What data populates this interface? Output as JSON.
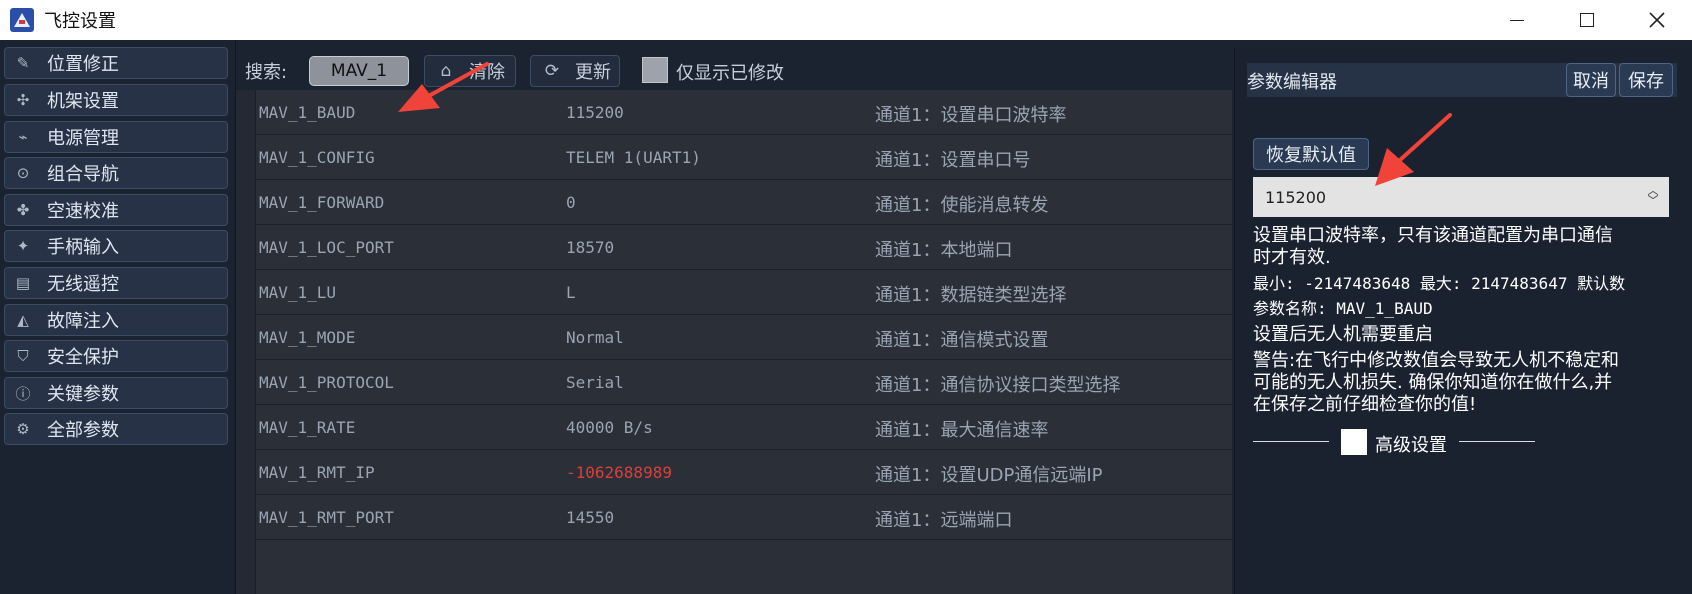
{
  "window": {
    "title": "飞控设置"
  },
  "sidebar": {
    "items": [
      {
        "label": "位置修正",
        "icon": "edit-icon"
      },
      {
        "label": "机架设置",
        "icon": "drone-icon"
      },
      {
        "label": "电源管理",
        "icon": "battery-icon"
      },
      {
        "label": "组合导航",
        "icon": "compass-icon"
      },
      {
        "label": "空速校准",
        "icon": "fan-icon"
      },
      {
        "label": "手柄输入",
        "icon": "gamepad-icon"
      },
      {
        "label": "无线遥控",
        "icon": "radio-icon"
      },
      {
        "label": "故障注入",
        "icon": "fault-icon"
      },
      {
        "label": "安全保护",
        "icon": "shield-icon"
      },
      {
        "label": "关键参数",
        "icon": "alert-icon"
      },
      {
        "label": "全部参数",
        "icon": "gears-icon"
      }
    ]
  },
  "toolbar": {
    "search_label": "搜索:",
    "search_value": "MAV_1",
    "clear_label": "清除",
    "refresh_label": "更新",
    "show_modified_label": "仅显示已修改"
  },
  "params": [
    {
      "name": "MAV_1_BAUD",
      "value": "115200",
      "desc": "通道1：设置串口波特率",
      "modified": false
    },
    {
      "name": "MAV_1_CONFIG",
      "value": "TELEM 1(UART1)",
      "desc": "通道1：设置串口号",
      "modified": false
    },
    {
      "name": "MAV_1_FORWARD",
      "value": "0",
      "desc": "通道1：使能消息转发",
      "modified": false
    },
    {
      "name": "MAV_1_LOC_PORT",
      "value": "18570",
      "desc": "通道1：本地端口",
      "modified": false
    },
    {
      "name": "MAV_1_LU",
      "value": "L",
      "desc": "通道1：数据链类型选择",
      "modified": false
    },
    {
      "name": "MAV_1_MODE",
      "value": "Normal",
      "desc": "通道1：通信模式设置",
      "modified": false
    },
    {
      "name": "MAV_1_PROTOCOL",
      "value": "Serial",
      "desc": "通道1：通信协议接口类型选择",
      "modified": false
    },
    {
      "name": "MAV_1_RATE",
      "value": "40000 B/s",
      "desc": "通道1：最大通信速率",
      "modified": false
    },
    {
      "name": "MAV_1_RMT_IP",
      "value": "-1062688989",
      "desc": "通道1：设置UDP通信远端IP",
      "modified": true
    },
    {
      "name": "MAV_1_RMT_PORT",
      "value": "14550",
      "desc": "通道1：远端端口",
      "modified": false
    }
  ],
  "editor": {
    "title": "参数编辑器",
    "cancel_label": "取消",
    "save_label": "保存",
    "restore_label": "恢复默认值",
    "value": "115200",
    "description_line1": "设置串口波特率，只有该通道配置为串口通信",
    "description_line2": "时才有效.",
    "range": "最小: -2147483648  最大: 2147483647  默认数",
    "param_name": "参数名称: MAV_1_BAUD",
    "reboot_note": "设置后无人机需要重启",
    "warning_line1": "警告:在飞行中修改数值会导致无人机不稳定和",
    "warning_line2": "可能的无人机损失. 确保你知道你在做什么,并",
    "warning_line3": "在保存之前仔细检查你的值!",
    "advanced_label": "高级设置"
  },
  "colors": {
    "modified_value": "#d9403a",
    "annotation_arrow": "#f0433a"
  }
}
